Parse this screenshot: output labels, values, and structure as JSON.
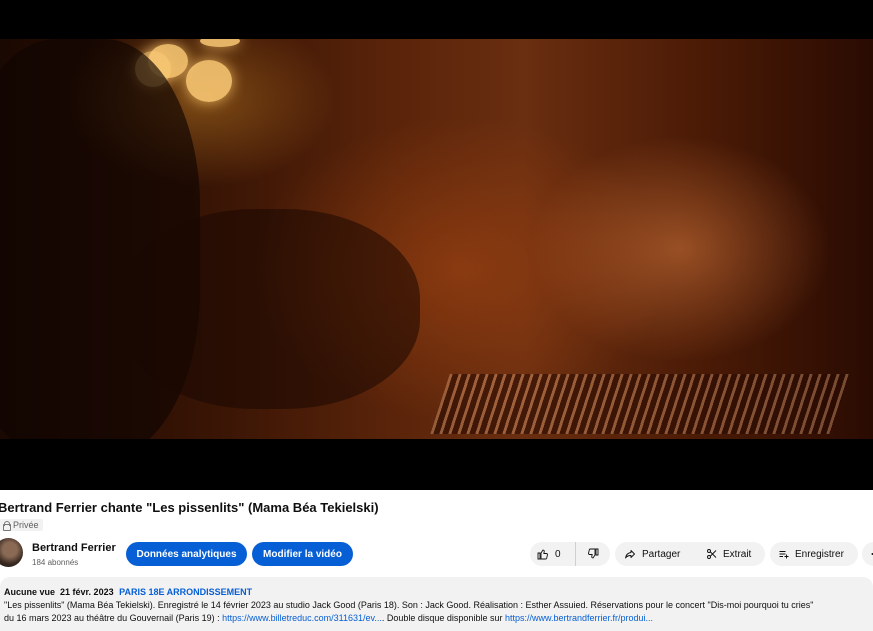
{
  "video": {
    "title": "Bertrand Ferrier chante \"Les pissenlits\" (Mama Béa Tekielski)",
    "privacy": "Privée"
  },
  "channel": {
    "name": "Bertrand Ferrier",
    "subscribers": "184 abonnés"
  },
  "actions": {
    "analytics": "Données analytiques",
    "edit": "Modifier la vidéo",
    "like_count": "0",
    "share": "Partager",
    "extract": "Extrait",
    "save": "Enregistrer"
  },
  "description": {
    "views": "Aucune vue",
    "date": "21 févr. 2023",
    "location_tag": "PARIS 18E ARRONDISSEMENT",
    "line1": "\"Les pissenlits\" (Mama Béa Tekielski). Enregistré le 14 février 2023 au studio Jack Good (Paris 18). Son : Jack Good. Réalisation : Esther Assuied. Réservations pour le concert \"Dis-moi pourquoi tu cries\"",
    "line2_prefix": "du 16 mars 2023 au théâtre du Gouvernail (Paris 19) : ",
    "link1": "https://www.billetreduc.com/311631/ev...",
    "line2_middle": ". Double disque disponible sur ",
    "link2": "https://www.bertrandferrier.fr/produi..."
  },
  "icons": {
    "like": "thumb-up-icon",
    "dislike": "thumb-down-icon",
    "share": "share-arrow-icon",
    "extract": "scissors-icon",
    "save": "playlist-add-icon",
    "privacy": "lock-icon"
  },
  "colors": {
    "accent": "#065fd4",
    "pill_bg": "#f2f2f2"
  }
}
